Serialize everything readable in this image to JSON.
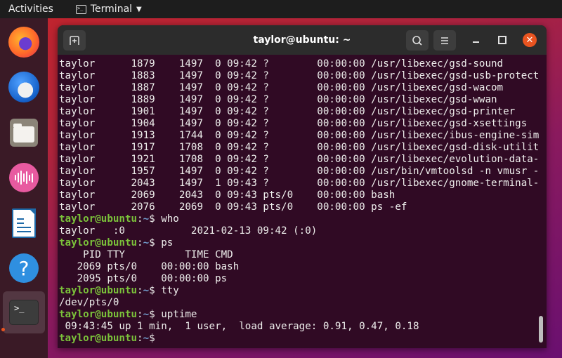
{
  "topbar": {
    "activities_label": "Activities",
    "app_name": "Terminal",
    "app_icon": "terminal-icon",
    "caret_icon": "caret-down-icon"
  },
  "dock": {
    "items": [
      {
        "name": "Firefox",
        "icon": "firefox-icon"
      },
      {
        "name": "Thunderbird",
        "icon": "thunderbird-icon"
      },
      {
        "name": "Files",
        "icon": "files-icon"
      },
      {
        "name": "Rhythmbox",
        "icon": "rhythmbox-icon"
      },
      {
        "name": "LibreOffice Writer",
        "icon": "writer-icon"
      },
      {
        "name": "Help",
        "icon": "help-icon",
        "glyph": "?"
      },
      {
        "name": "Terminal",
        "icon": "terminal-icon",
        "glyph": ">_",
        "active": true
      }
    ]
  },
  "window": {
    "title": "taylor@ubuntu: ~",
    "buttons": {
      "new_tab": "new-tab-icon",
      "search": "search-icon",
      "menu": "hamburger-menu-icon",
      "minimize": "minimize-icon",
      "maximize": "maximize-icon",
      "close": "close-icon"
    },
    "colors": {
      "terminal_bg": "#300a24",
      "prompt_user": "#7bc23a",
      "prompt_path": "#729fcf",
      "close_button": "#e95420"
    }
  },
  "terminal": {
    "prompt_user": "taylor@ubuntu",
    "prompt_sep": ":",
    "prompt_path": "~",
    "prompt_symbol": "$",
    "lines": [
      {
        "type": "out",
        "text": "taylor      1879    1497  0 09:42 ?        00:00:00 /usr/libexec/gsd-sound"
      },
      {
        "type": "out",
        "text": "taylor      1883    1497  0 09:42 ?        00:00:00 /usr/libexec/gsd-usb-protect"
      },
      {
        "type": "out",
        "text": "taylor      1887    1497  0 09:42 ?        00:00:00 /usr/libexec/gsd-wacom"
      },
      {
        "type": "out",
        "text": "taylor      1889    1497  0 09:42 ?        00:00:00 /usr/libexec/gsd-wwan"
      },
      {
        "type": "out",
        "text": "taylor      1901    1497  0 09:42 ?        00:00:00 /usr/libexec/gsd-printer"
      },
      {
        "type": "out",
        "text": "taylor      1904    1497  0 09:42 ?        00:00:00 /usr/libexec/gsd-xsettings"
      },
      {
        "type": "out",
        "text": "taylor      1913    1744  0 09:42 ?        00:00:00 /usr/libexec/ibus-engine-sim"
      },
      {
        "type": "out",
        "text": "taylor      1917    1708  0 09:42 ?        00:00:00 /usr/libexec/gsd-disk-utilit"
      },
      {
        "type": "out",
        "text": "taylor      1921    1708  0 09:42 ?        00:00:00 /usr/libexec/evolution-data-"
      },
      {
        "type": "out",
        "text": "taylor      1957    1497  0 09:42 ?        00:00:00 /usr/bin/vmtoolsd -n vmusr -"
      },
      {
        "type": "out",
        "text": "taylor      2043    1497  1 09:43 ?        00:00:00 /usr/libexec/gnome-terminal-"
      },
      {
        "type": "out",
        "text": "taylor      2069    2043  0 09:43 pts/0    00:00:00 bash"
      },
      {
        "type": "out",
        "text": "taylor      2076    2069  0 09:43 pts/0    00:00:00 ps -ef"
      },
      {
        "type": "cmd",
        "text": " who"
      },
      {
        "type": "out",
        "text": "taylor   :0           2021-02-13 09:42 (:0)"
      },
      {
        "type": "cmd",
        "text": " ps"
      },
      {
        "type": "out",
        "text": "    PID TTY          TIME CMD"
      },
      {
        "type": "out",
        "text": "   2069 pts/0    00:00:00 bash"
      },
      {
        "type": "out",
        "text": "   2095 pts/0    00:00:00 ps"
      },
      {
        "type": "cmd",
        "text": " tty"
      },
      {
        "type": "out",
        "text": "/dev/pts/0"
      },
      {
        "type": "cmd",
        "text": " uptime"
      },
      {
        "type": "out",
        "text": " 09:43:45 up 1 min,  1 user,  load average: 0.91, 0.47, 0.18"
      },
      {
        "type": "cmd",
        "text": ""
      }
    ]
  }
}
